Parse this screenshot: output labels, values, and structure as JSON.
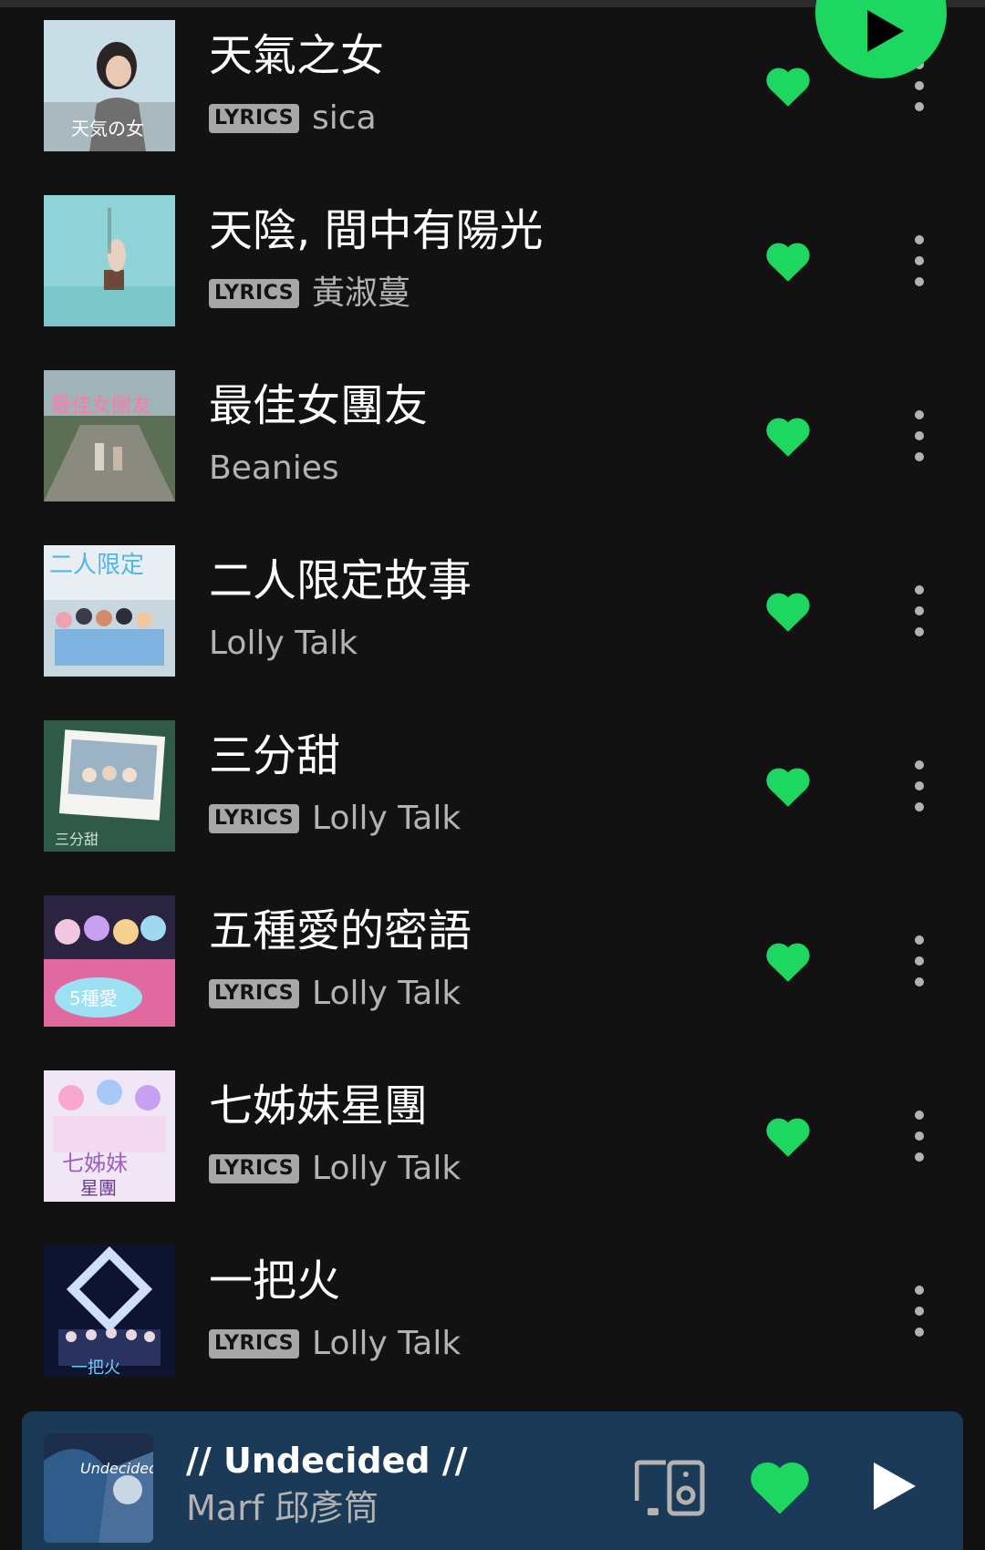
{
  "colors": {
    "background": "#121212",
    "accent": "#1ed760",
    "text_primary": "#ffffff",
    "text_secondary": "#b3b3b3",
    "mini_player_bg": "#1b3a57"
  },
  "tracks": [
    {
      "title": "天氣之女",
      "lyrics_badge": "LYRICS",
      "artist": "sica",
      "liked": true
    },
    {
      "title": "天陰, 間中有陽光",
      "lyrics_badge": "LYRICS",
      "artist": "黃淑蔓",
      "liked": true
    },
    {
      "title": "最佳女團友",
      "lyrics_badge": "",
      "artist": "Beanies",
      "liked": true
    },
    {
      "title": "二人限定故事",
      "lyrics_badge": "",
      "artist": "Lolly Talk",
      "liked": true
    },
    {
      "title": "三分甜",
      "lyrics_badge": "LYRICS",
      "artist": "Lolly Talk",
      "liked": true
    },
    {
      "title": "五種愛的密語",
      "lyrics_badge": "LYRICS",
      "artist": "Lolly Talk",
      "liked": true
    },
    {
      "title": "七姊妹星團",
      "lyrics_badge": "LYRICS",
      "artist": "Lolly Talk",
      "liked": true
    },
    {
      "title": "一把火",
      "lyrics_badge": "LYRICS",
      "artist": "Lolly Talk",
      "liked": false
    }
  ],
  "now_playing": {
    "title": "// Undecided //",
    "artist": "Marf 邱彥筒",
    "liked": true,
    "icons": [
      "device-connect-icon",
      "heart-icon",
      "play-icon"
    ]
  }
}
